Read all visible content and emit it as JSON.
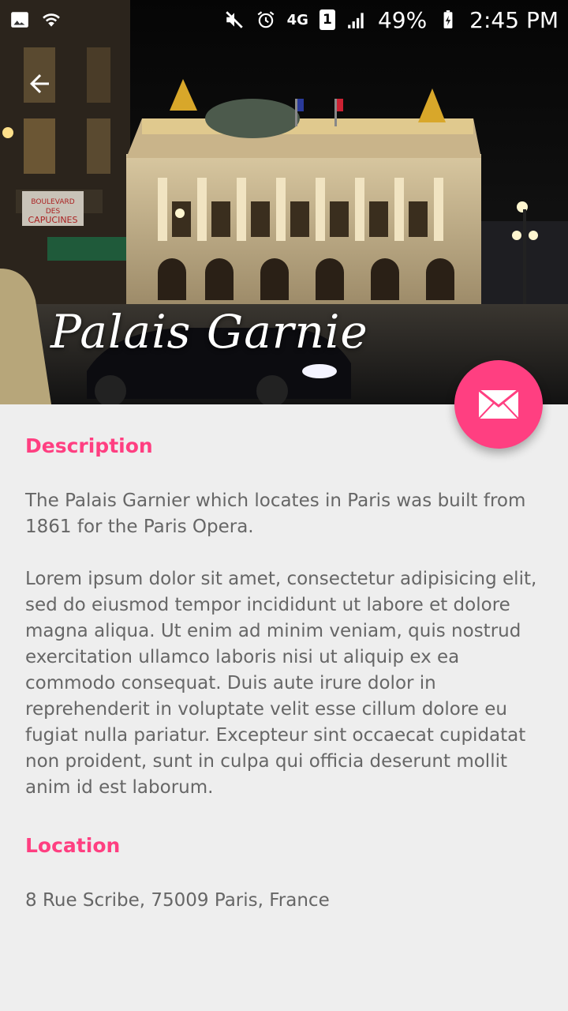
{
  "status_bar": {
    "battery": "49%",
    "time": "2:45 PM",
    "network": "4G",
    "sim": "1",
    "icons": [
      "image-icon",
      "wifi-icon",
      "mute-icon",
      "alarm-icon",
      "network-4g-icon",
      "sim-icon",
      "signal-icon",
      "battery-icon"
    ]
  },
  "header": {
    "title": "Palais Garnie",
    "back_icon": "arrow-back-icon",
    "sign_text": "BOULEVARD DES CAPUCINES"
  },
  "fab": {
    "icon": "mail-icon",
    "color": "#ff3f81"
  },
  "description": {
    "title": "Description",
    "intro": "The Palais Garnier which locates in Paris was built from 1861 for the Paris Opera.",
    "body": "Lorem ipsum dolor sit amet, consectetur adipisicing elit, sed do eiusmod tempor incididunt ut labore et dolore magna aliqua. Ut enim ad minim veniam, quis nostrud exercitation ullamco laboris nisi ut aliquip ex ea commodo consequat. Duis aute irure dolor in reprehenderit in voluptate velit esse cillum dolore eu fugiat nulla pariatur. Excepteur sint occaecat cupidatat non proident, sunt in culpa qui officia deserunt mollit anim id est laborum."
  },
  "location": {
    "title": "Location",
    "address": "8 Rue Scribe, 75009 Paris, France"
  },
  "colors": {
    "accent": "#ff3f81",
    "background": "#eeeeee",
    "text": "#666666"
  }
}
